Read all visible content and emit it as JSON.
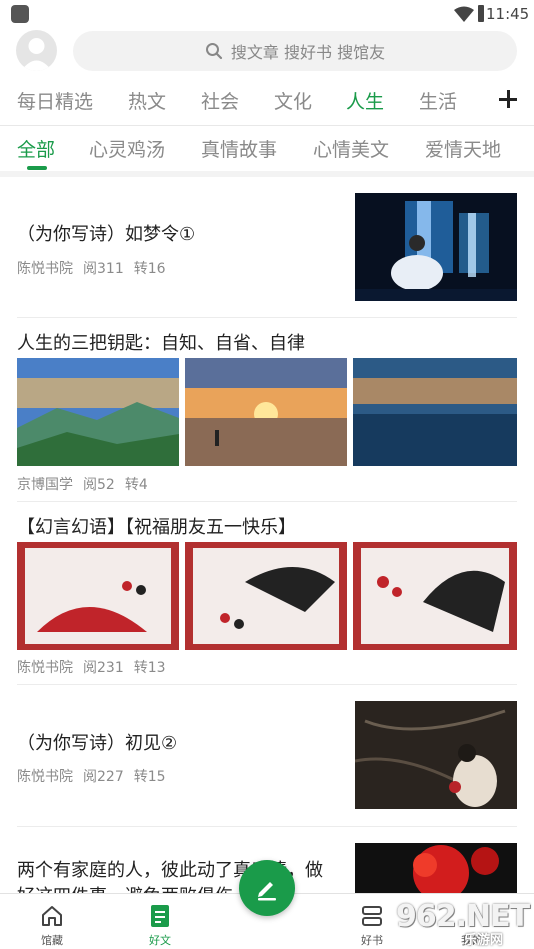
{
  "status": {
    "time": "11:45"
  },
  "header": {
    "search_placeholder": "搜文章 搜好书 搜馆友"
  },
  "categories": [
    "每日精选",
    "热文",
    "社会",
    "文化",
    "人生",
    "生活"
  ],
  "active_category": "人生",
  "subtabs": [
    "全部",
    "心灵鸡汤",
    "真情故事",
    "心情美文",
    "爱情天地"
  ],
  "active_subtab": "全部",
  "feed": [
    {
      "title": "（为你写诗）如梦令①",
      "source": "陈悦书院",
      "reads": "阅311",
      "shares": "转16",
      "image": "painting-ancient-lady-waterfall"
    },
    {
      "title": "人生的三把钥匙：自知、自省、自律",
      "source": "京博国学",
      "reads": "阅52",
      "shares": "转4",
      "images": [
        "landscape-mountains-sky",
        "sunset-beach",
        "evening-sea-clouds"
      ]
    },
    {
      "title": "【幻言幻语】【祝福朋友五一快乐】",
      "source": "陈悦书院",
      "reads": "阅231",
      "shares": "转13",
      "images": [
        "red-fan-tassel",
        "black-fan-beads",
        "black-fan-plum"
      ]
    },
    {
      "title": "（为你写诗）初见②",
      "source": "陈悦书院",
      "reads": "阅227",
      "shares": "转15",
      "image": "painting-lady-dark-branches"
    },
    {
      "title_line1": "两个有家庭的人，彼此动了真感情，做",
      "title_line2": "好这四件事，避免两败俱伤",
      "image": "red-roses"
    }
  ],
  "bottom_nav": {
    "items": [
      {
        "label": "馆藏",
        "icon": "home-icon"
      },
      {
        "label": "好文",
        "icon": "article-icon"
      },
      {
        "label": "好书",
        "icon": "book-icon"
      },
      {
        "label": "我的",
        "icon": "profile-icon"
      }
    ],
    "fab_icon": "pen-icon"
  },
  "watermark": {
    "text": "962.NET",
    "sub": "乐游网"
  },
  "colors": {
    "accent": "#1a9b4a",
    "muted": "#8a8a8a"
  }
}
